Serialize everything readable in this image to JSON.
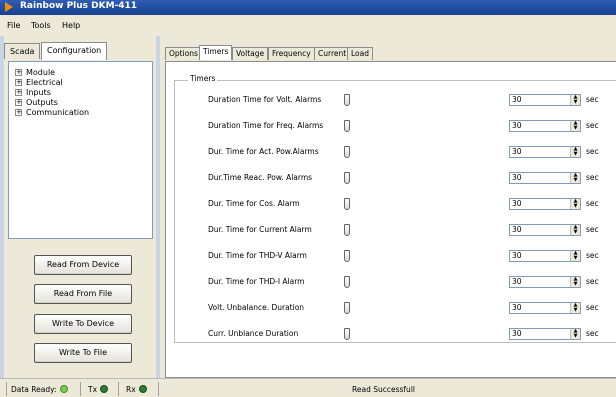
{
  "window": {
    "title": "Rainbow Plus DKM-411"
  },
  "menu": [
    "File",
    "Tools",
    "Help"
  ],
  "left_tabs": [
    {
      "label": "Scada",
      "active": false
    },
    {
      "label": "Configuration",
      "active": true
    }
  ],
  "tree": [
    "Module",
    "Electrical",
    "Inputs",
    "Outputs",
    "Communication"
  ],
  "actions": {
    "read_device": "Read From Device",
    "read_file": "Read From File",
    "write_device": "Write To Device",
    "write_file": "Write To File"
  },
  "tabs": [
    {
      "label": "Options",
      "active": false
    },
    {
      "label": "Timers",
      "active": true
    },
    {
      "label": "Voltage",
      "active": false
    },
    {
      "label": "Frequency",
      "active": false
    },
    {
      "label": "Current",
      "active": false
    },
    {
      "label": "Load",
      "active": false
    }
  ],
  "group_title": "Timers",
  "timers": [
    {
      "label": "Duration Time for Volt. Alarms",
      "value": "30",
      "unit": "sec"
    },
    {
      "label": "Duration Time for Freq. Alarms",
      "value": "30",
      "unit": "sec"
    },
    {
      "label": "Dur. Time for Act. Pow.Alarms",
      "value": "30",
      "unit": "sec"
    },
    {
      "label": "Dur.Time Reac. Pow. Alarms",
      "value": "30",
      "unit": "sec"
    },
    {
      "label": "Dur. Time for Cos. Alarm",
      "value": "30",
      "unit": "sec"
    },
    {
      "label": "Dur. Time for Current Alarm",
      "value": "30",
      "unit": "sec"
    },
    {
      "label": "Dur. Time for THD-V Alarm",
      "value": "30",
      "unit": "sec"
    },
    {
      "label": "Dur. Time for THD-I Alarm",
      "value": "30",
      "unit": "sec"
    },
    {
      "label": "Volt. Unbalance. Duration",
      "value": "30",
      "unit": "sec"
    },
    {
      "label": "Curr. Unblance Duration",
      "value": "30",
      "unit": "sec"
    }
  ],
  "status": {
    "data_ready": "Data Ready:",
    "tx": "Tx",
    "rx": "Rx",
    "message": "Read Successfull",
    "colors": {
      "data_ready": "#7ec852",
      "tx": "#2e7d32",
      "rx": "#2e7d32"
    }
  }
}
